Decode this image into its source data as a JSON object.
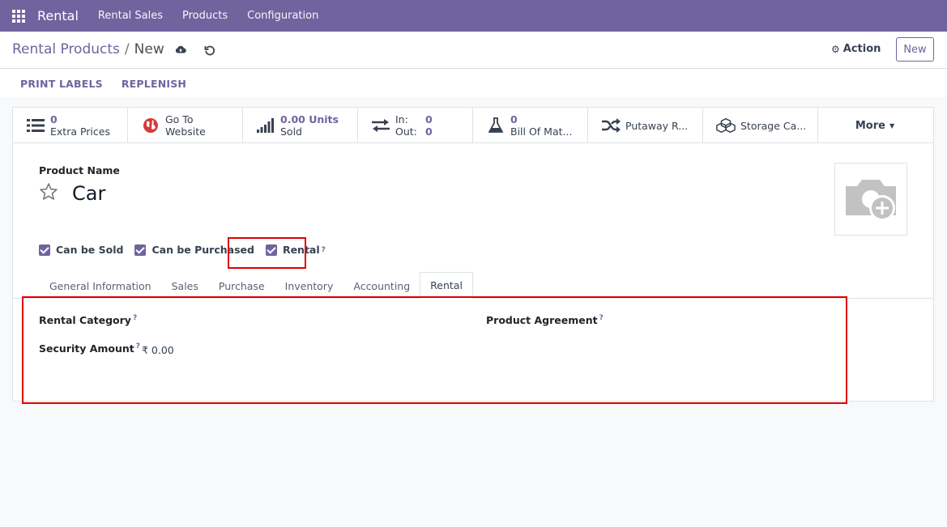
{
  "nav": {
    "app_icon": "apps-grid-icon",
    "brand": "Rental",
    "menus": [
      "Rental Sales",
      "Products",
      "Configuration"
    ]
  },
  "breadcrumb": {
    "parent": "Rental Products",
    "separator": "/",
    "current": "New"
  },
  "control": {
    "save_icon": "cloud-upload-icon",
    "discard_icon": "undo-icon",
    "action_label": "Action",
    "new_label": "New"
  },
  "statusbar": {
    "print_labels": "PRINT LABELS",
    "replenish": "REPLENISH"
  },
  "smart_buttons": {
    "extra_prices": {
      "value": "0",
      "label": "Extra Prices",
      "icon": "list-icon"
    },
    "website": {
      "line1": "Go To",
      "line2": "Website",
      "icon": "globe-icon"
    },
    "sold": {
      "value": "0.00 Units",
      "label": "Sold",
      "icon": "signal-bars-icon"
    },
    "in_out": {
      "in_label": "In:",
      "in_value": "0",
      "out_label": "Out:",
      "out_value": "0",
      "icon": "exchange-arrows-icon"
    },
    "bom": {
      "value": "0",
      "label": "Bill Of Mat...",
      "icon": "flask-icon"
    },
    "putaway": {
      "label": "Putaway R...",
      "icon": "random-icon"
    },
    "storage": {
      "label": "Storage Ca...",
      "icon": "cubes-icon"
    },
    "more": "More"
  },
  "form": {
    "product_name_label": "Product Name",
    "product_name": "Car",
    "checkboxes": {
      "can_be_sold": "Can be Sold",
      "can_be_purchased": "Can be Purchased",
      "rental": "Rental",
      "rental_help": "?"
    },
    "tabs": [
      "General Information",
      "Sales",
      "Purchase",
      "Inventory",
      "Accounting",
      "Rental"
    ],
    "active_tab": "Rental",
    "rental_tab": {
      "rental_category": "Rental Category",
      "product_agreement": "Product Agreement",
      "security_amount": "Security Amount",
      "security_amount_value": "₹ 0.00",
      "help": "?"
    }
  },
  "colors": {
    "primary": "#71639e",
    "highlight": "#e00000"
  }
}
